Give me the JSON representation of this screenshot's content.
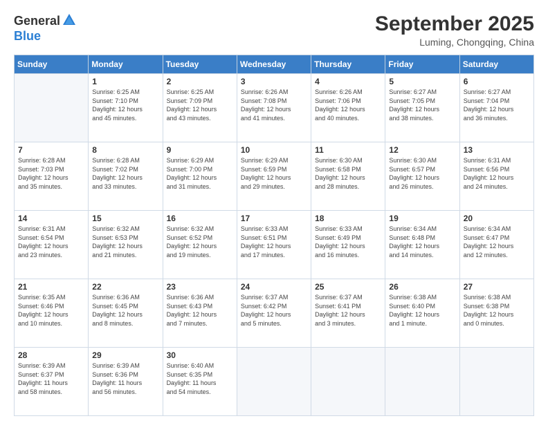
{
  "logo": {
    "general": "General",
    "blue": "Blue"
  },
  "title": "September 2025",
  "subtitle": "Luming, Chongqing, China",
  "header": {
    "days": [
      "Sunday",
      "Monday",
      "Tuesday",
      "Wednesday",
      "Thursday",
      "Friday",
      "Saturday"
    ]
  },
  "weeks": [
    [
      {
        "day": "",
        "info": ""
      },
      {
        "day": "1",
        "info": "Sunrise: 6:25 AM\nSunset: 7:10 PM\nDaylight: 12 hours\nand 45 minutes."
      },
      {
        "day": "2",
        "info": "Sunrise: 6:25 AM\nSunset: 7:09 PM\nDaylight: 12 hours\nand 43 minutes."
      },
      {
        "day": "3",
        "info": "Sunrise: 6:26 AM\nSunset: 7:08 PM\nDaylight: 12 hours\nand 41 minutes."
      },
      {
        "day": "4",
        "info": "Sunrise: 6:26 AM\nSunset: 7:06 PM\nDaylight: 12 hours\nand 40 minutes."
      },
      {
        "day": "5",
        "info": "Sunrise: 6:27 AM\nSunset: 7:05 PM\nDaylight: 12 hours\nand 38 minutes."
      },
      {
        "day": "6",
        "info": "Sunrise: 6:27 AM\nSunset: 7:04 PM\nDaylight: 12 hours\nand 36 minutes."
      }
    ],
    [
      {
        "day": "7",
        "info": "Sunrise: 6:28 AM\nSunset: 7:03 PM\nDaylight: 12 hours\nand 35 minutes."
      },
      {
        "day": "8",
        "info": "Sunrise: 6:28 AM\nSunset: 7:02 PM\nDaylight: 12 hours\nand 33 minutes."
      },
      {
        "day": "9",
        "info": "Sunrise: 6:29 AM\nSunset: 7:00 PM\nDaylight: 12 hours\nand 31 minutes."
      },
      {
        "day": "10",
        "info": "Sunrise: 6:29 AM\nSunset: 6:59 PM\nDaylight: 12 hours\nand 29 minutes."
      },
      {
        "day": "11",
        "info": "Sunrise: 6:30 AM\nSunset: 6:58 PM\nDaylight: 12 hours\nand 28 minutes."
      },
      {
        "day": "12",
        "info": "Sunrise: 6:30 AM\nSunset: 6:57 PM\nDaylight: 12 hours\nand 26 minutes."
      },
      {
        "day": "13",
        "info": "Sunrise: 6:31 AM\nSunset: 6:56 PM\nDaylight: 12 hours\nand 24 minutes."
      }
    ],
    [
      {
        "day": "14",
        "info": "Sunrise: 6:31 AM\nSunset: 6:54 PM\nDaylight: 12 hours\nand 23 minutes."
      },
      {
        "day": "15",
        "info": "Sunrise: 6:32 AM\nSunset: 6:53 PM\nDaylight: 12 hours\nand 21 minutes."
      },
      {
        "day": "16",
        "info": "Sunrise: 6:32 AM\nSunset: 6:52 PM\nDaylight: 12 hours\nand 19 minutes."
      },
      {
        "day": "17",
        "info": "Sunrise: 6:33 AM\nSunset: 6:51 PM\nDaylight: 12 hours\nand 17 minutes."
      },
      {
        "day": "18",
        "info": "Sunrise: 6:33 AM\nSunset: 6:49 PM\nDaylight: 12 hours\nand 16 minutes."
      },
      {
        "day": "19",
        "info": "Sunrise: 6:34 AM\nSunset: 6:48 PM\nDaylight: 12 hours\nand 14 minutes."
      },
      {
        "day": "20",
        "info": "Sunrise: 6:34 AM\nSunset: 6:47 PM\nDaylight: 12 hours\nand 12 minutes."
      }
    ],
    [
      {
        "day": "21",
        "info": "Sunrise: 6:35 AM\nSunset: 6:46 PM\nDaylight: 12 hours\nand 10 minutes."
      },
      {
        "day": "22",
        "info": "Sunrise: 6:36 AM\nSunset: 6:45 PM\nDaylight: 12 hours\nand 8 minutes."
      },
      {
        "day": "23",
        "info": "Sunrise: 6:36 AM\nSunset: 6:43 PM\nDaylight: 12 hours\nand 7 minutes."
      },
      {
        "day": "24",
        "info": "Sunrise: 6:37 AM\nSunset: 6:42 PM\nDaylight: 12 hours\nand 5 minutes."
      },
      {
        "day": "25",
        "info": "Sunrise: 6:37 AM\nSunset: 6:41 PM\nDaylight: 12 hours\nand 3 minutes."
      },
      {
        "day": "26",
        "info": "Sunrise: 6:38 AM\nSunset: 6:40 PM\nDaylight: 12 hours\nand 1 minute."
      },
      {
        "day": "27",
        "info": "Sunrise: 6:38 AM\nSunset: 6:38 PM\nDaylight: 12 hours\nand 0 minutes."
      }
    ],
    [
      {
        "day": "28",
        "info": "Sunrise: 6:39 AM\nSunset: 6:37 PM\nDaylight: 11 hours\nand 58 minutes."
      },
      {
        "day": "29",
        "info": "Sunrise: 6:39 AM\nSunset: 6:36 PM\nDaylight: 11 hours\nand 56 minutes."
      },
      {
        "day": "30",
        "info": "Sunrise: 6:40 AM\nSunset: 6:35 PM\nDaylight: 11 hours\nand 54 minutes."
      },
      {
        "day": "",
        "info": ""
      },
      {
        "day": "",
        "info": ""
      },
      {
        "day": "",
        "info": ""
      },
      {
        "day": "",
        "info": ""
      }
    ]
  ]
}
